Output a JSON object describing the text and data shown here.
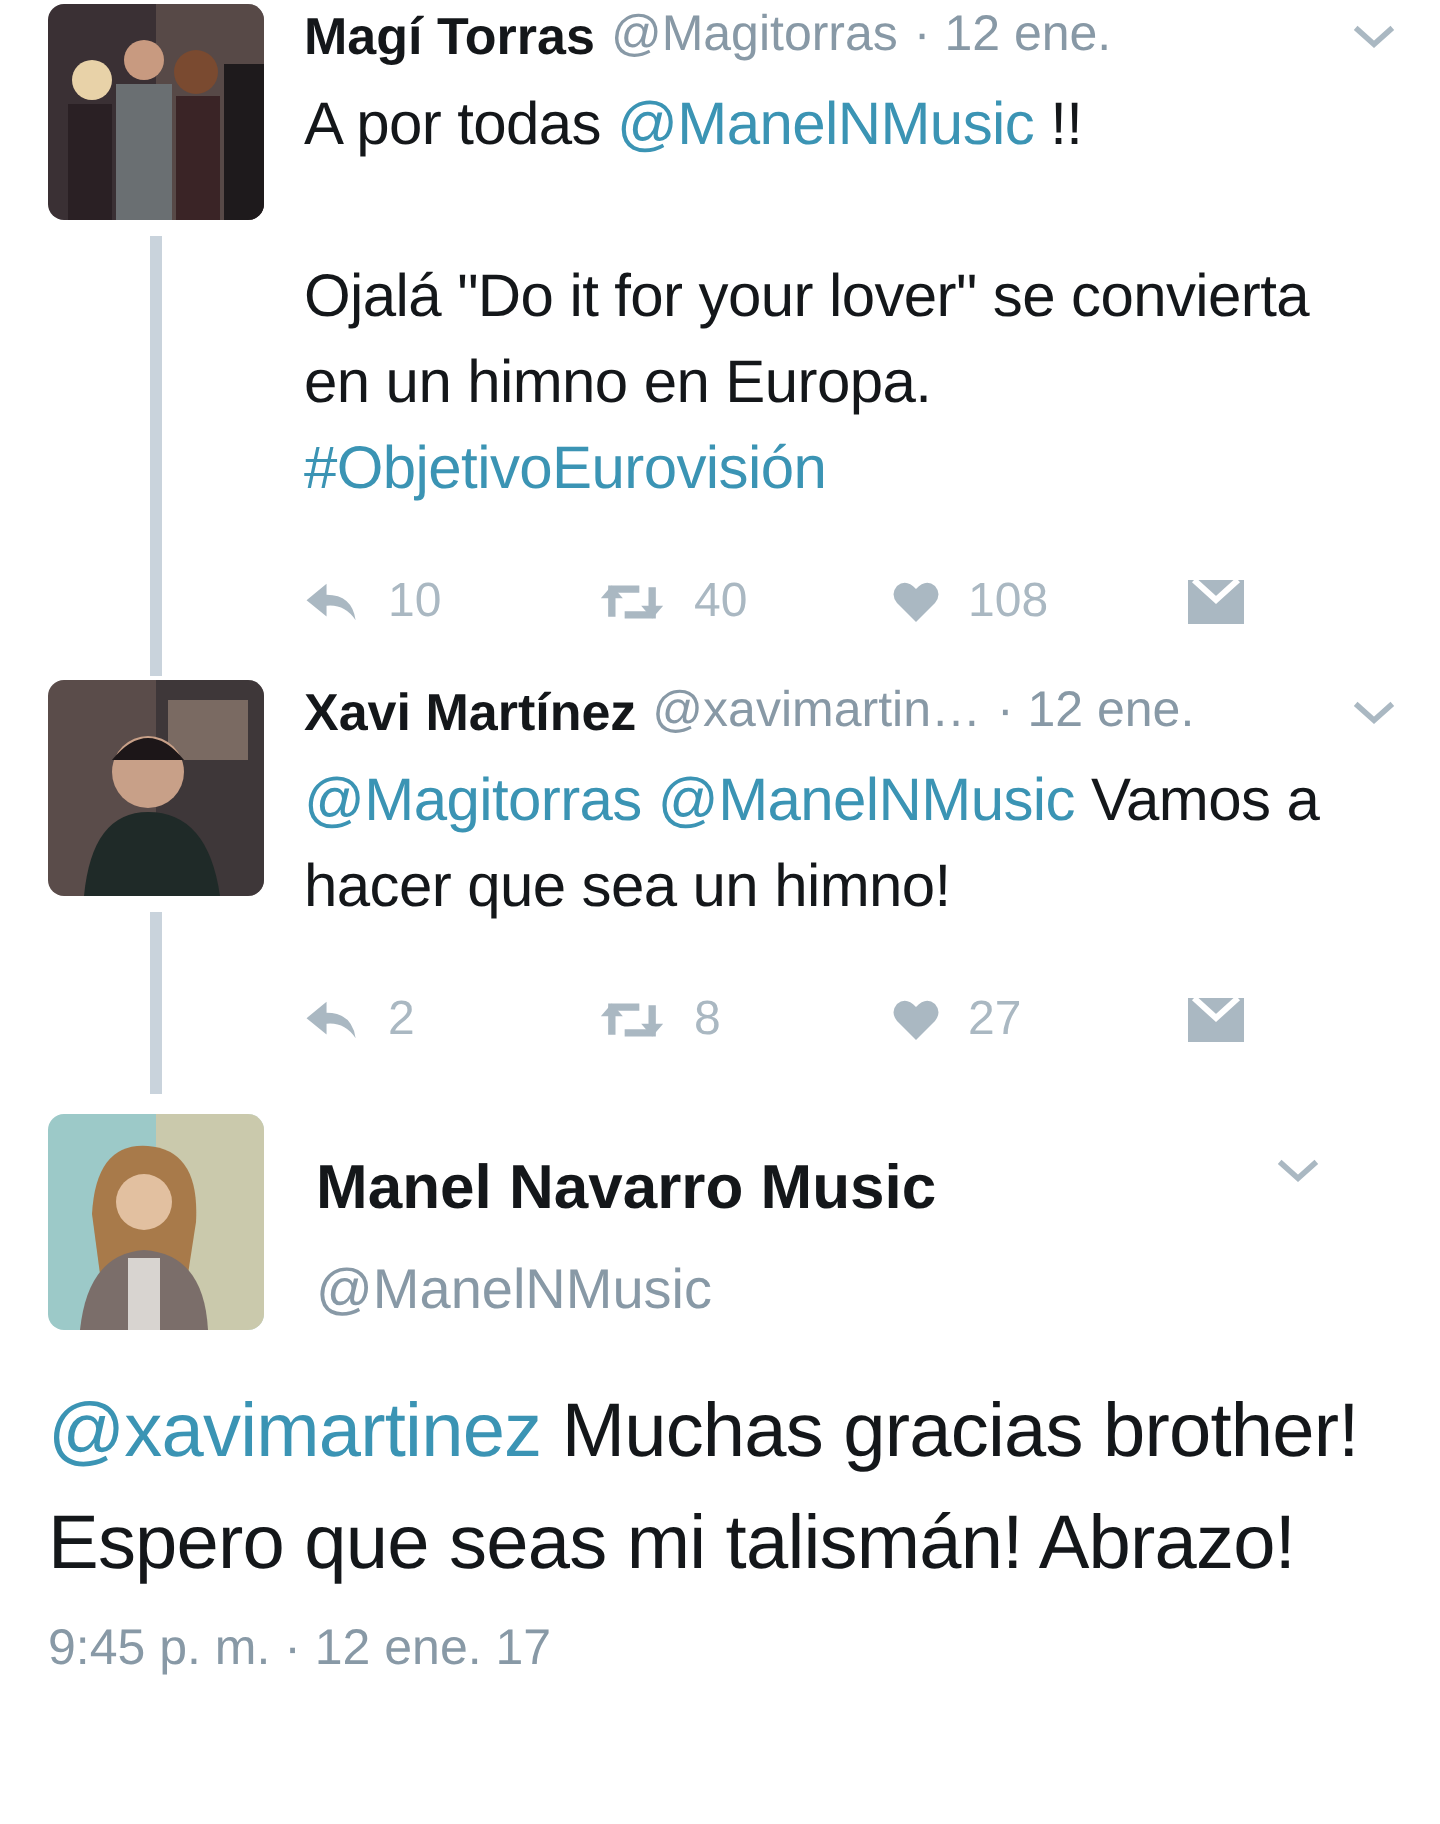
{
  "thread": [
    {
      "name": "Magí Torras",
      "handle": "@Magitorras",
      "time": "· 12 ene.",
      "paragraphs": [
        [
          {
            "kind": "text",
            "text": "A por todas "
          },
          {
            "kind": "link",
            "text": "@ManelNMusic"
          },
          {
            "kind": "text",
            "text": " !!"
          }
        ],
        [
          {
            "kind": "text",
            "text": "Ojalá \"Do it for your lover\" se convierta en un himno en Europa."
          },
          {
            "kind": "break"
          },
          {
            "kind": "link",
            "text": "#ObjetivoEurovisión"
          }
        ]
      ],
      "actions": [
        {
          "kind": "reply",
          "count": "10"
        },
        {
          "kind": "retweet",
          "count": "40"
        },
        {
          "kind": "like",
          "count": "108"
        },
        {
          "kind": "message"
        }
      ]
    },
    {
      "name": "Xavi Martínez",
      "handle": "@xavimartin…",
      "time": "· 12 ene.",
      "paragraphs": [
        [
          {
            "kind": "link",
            "text": "@Magitorras"
          },
          {
            "kind": "space"
          },
          {
            "kind": "link",
            "text": "@ManelNMusic"
          },
          {
            "kind": "text",
            "text": " Vamos a hacer que sea un himno!"
          }
        ]
      ],
      "actions": [
        {
          "kind": "reply",
          "count": "2"
        },
        {
          "kind": "retweet",
          "count": "8"
        },
        {
          "kind": "like",
          "count": "27"
        },
        {
          "kind": "message"
        }
      ]
    }
  ],
  "main_tweet": {
    "name": "Manel Navarro Music",
    "handle": "@ManelNMusic",
    "body": [
      {
        "kind": "link",
        "text": "@xavimartinez"
      },
      {
        "kind": "text",
        "text": " Muchas gracias brother! Espero que seas mi talismán! Abrazo!"
      }
    ],
    "timestamp": "9:45 p. m. · 12 ene. 17"
  }
}
